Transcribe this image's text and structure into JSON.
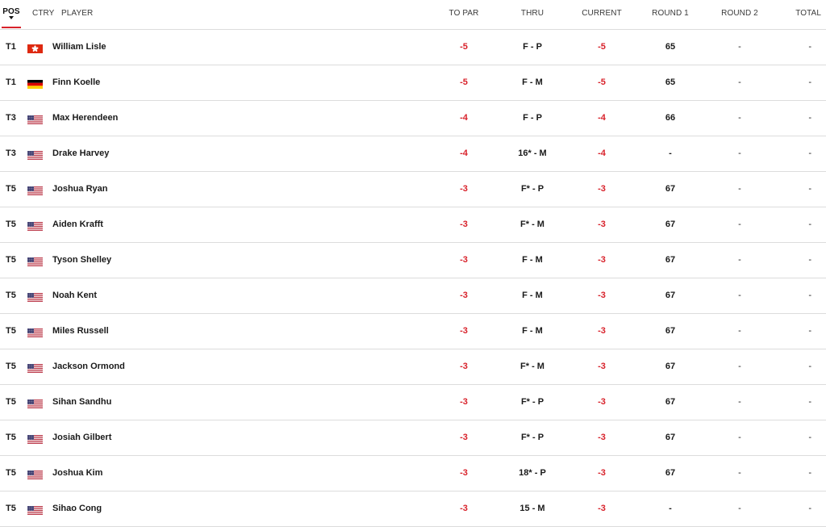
{
  "header": {
    "pos": "POS",
    "ctry": "CTRY",
    "player": "PLAYER",
    "to_par": "TO PAR",
    "thru": "THRU",
    "current": "CURRENT",
    "round1": "ROUND 1",
    "round2": "ROUND 2",
    "total": "TOTAL"
  },
  "colors": {
    "accent": "#d8222b",
    "divider": "#dcdcdc"
  },
  "rows": [
    {
      "pos": "T1",
      "country": "hong-kong-flag-icon",
      "player": "William Lisle",
      "to_par": "-5",
      "thru": "F - P",
      "current": "-5",
      "round1": "65",
      "round2": "-",
      "total": "-"
    },
    {
      "pos": "T1",
      "country": "germany-flag-icon",
      "player": "Finn Koelle",
      "to_par": "-5",
      "thru": "F - M",
      "current": "-5",
      "round1": "65",
      "round2": "-",
      "total": "-"
    },
    {
      "pos": "T3",
      "country": "usa-flag-icon",
      "player": "Max Herendeen",
      "to_par": "-4",
      "thru": "F - P",
      "current": "-4",
      "round1": "66",
      "round2": "-",
      "total": "-"
    },
    {
      "pos": "T3",
      "country": "usa-flag-icon",
      "player": "Drake Harvey",
      "to_par": "-4",
      "thru": "16* - M",
      "current": "-4",
      "round1": "-",
      "round2": "-",
      "total": "-"
    },
    {
      "pos": "T5",
      "country": "usa-flag-icon",
      "player": "Joshua Ryan",
      "to_par": "-3",
      "thru": "F* - P",
      "current": "-3",
      "round1": "67",
      "round2": "-",
      "total": "-"
    },
    {
      "pos": "T5",
      "country": "usa-flag-icon",
      "player": "Aiden Krafft",
      "to_par": "-3",
      "thru": "F* - M",
      "current": "-3",
      "round1": "67",
      "round2": "-",
      "total": "-"
    },
    {
      "pos": "T5",
      "country": "usa-flag-icon",
      "player": "Tyson Shelley",
      "to_par": "-3",
      "thru": "F - M",
      "current": "-3",
      "round1": "67",
      "round2": "-",
      "total": "-"
    },
    {
      "pos": "T5",
      "country": "usa-flag-icon",
      "player": "Noah Kent",
      "to_par": "-3",
      "thru": "F - M",
      "current": "-3",
      "round1": "67",
      "round2": "-",
      "total": "-"
    },
    {
      "pos": "T5",
      "country": "usa-flag-icon",
      "player": "Miles Russell",
      "to_par": "-3",
      "thru": "F - M",
      "current": "-3",
      "round1": "67",
      "round2": "-",
      "total": "-"
    },
    {
      "pos": "T5",
      "country": "usa-flag-icon",
      "player": "Jackson Ormond",
      "to_par": "-3",
      "thru": "F* - M",
      "current": "-3",
      "round1": "67",
      "round2": "-",
      "total": "-"
    },
    {
      "pos": "T5",
      "country": "usa-flag-icon",
      "player": "Sihan Sandhu",
      "to_par": "-3",
      "thru": "F* - P",
      "current": "-3",
      "round1": "67",
      "round2": "-",
      "total": "-"
    },
    {
      "pos": "T5",
      "country": "usa-flag-icon",
      "player": "Josiah Gilbert",
      "to_par": "-3",
      "thru": "F* - P",
      "current": "-3",
      "round1": "67",
      "round2": "-",
      "total": "-"
    },
    {
      "pos": "T5",
      "country": "usa-flag-icon",
      "player": "Joshua Kim",
      "to_par": "-3",
      "thru": "18* - P",
      "current": "-3",
      "round1": "67",
      "round2": "-",
      "total": "-"
    },
    {
      "pos": "T5",
      "country": "usa-flag-icon",
      "player": "Sihao Cong",
      "to_par": "-3",
      "thru": "15 - M",
      "current": "-3",
      "round1": "-",
      "round2": "-",
      "total": "-"
    }
  ]
}
